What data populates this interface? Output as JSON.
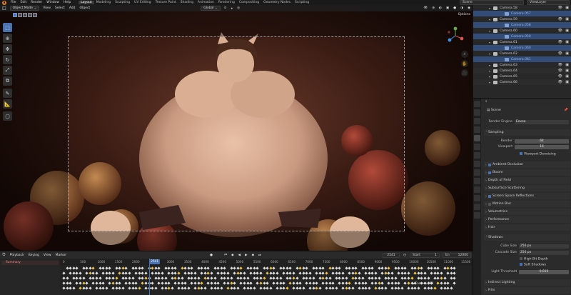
{
  "topbar": {
    "menus": [
      "File",
      "Edit",
      "Render",
      "Window",
      "Help"
    ],
    "workspaces": [
      "Layout",
      "Modeling",
      "Sculpting",
      "UV Editing",
      "Texture Paint",
      "Shading",
      "Animation",
      "Rendering",
      "Compositing",
      "Geometry Nodes",
      "Scripting"
    ],
    "scene_label": "Scene",
    "viewlayer_label": "ViewLayer"
  },
  "viewport": {
    "mode": "Object Mode",
    "menus": [
      "View",
      "Select",
      "Add",
      "Object"
    ],
    "transform_orientation": "Global",
    "options_label": "Options"
  },
  "timeline": {
    "menus": [
      "Playback",
      "Keying",
      "View",
      "Marker"
    ],
    "current_frame": "2541",
    "start_label": "Start",
    "start_value": "1",
    "end_label": "En",
    "end_value": "12000",
    "summary_label": "Summary",
    "ticks": [
      "0",
      "500",
      "1000",
      "1500",
      "2000",
      "2541",
      "3000",
      "3500",
      "4000",
      "4500",
      "5000",
      "5500",
      "6000",
      "6500",
      "7000",
      "7500",
      "8000",
      "8500",
      "9000",
      "9500",
      "10000",
      "10500",
      "11000",
      "11500"
    ],
    "marker_label": "Camera.063"
  },
  "outliner": {
    "rows": [
      {
        "name": "Camera.58",
        "kind": "object",
        "selected": false
      },
      {
        "name": "Camera.057",
        "kind": "camera",
        "selected": true
      },
      {
        "name": "Camera.59",
        "kind": "object",
        "selected": false
      },
      {
        "name": "Camera.058",
        "kind": "camera",
        "selected": true
      },
      {
        "name": "Camera.60",
        "kind": "object",
        "selected": false
      },
      {
        "name": "Camera.059",
        "kind": "camera",
        "selected": true
      },
      {
        "name": "Camera.61",
        "kind": "object",
        "selected": false
      },
      {
        "name": "Camera.060",
        "kind": "camera",
        "selected": true
      },
      {
        "name": "Camera.62",
        "kind": "object",
        "selected": false
      },
      {
        "name": "Camera.061",
        "kind": "camera",
        "selected": true
      },
      {
        "name": "Camera.63",
        "kind": "object",
        "selected": false
      },
      {
        "name": "Camera.64",
        "kind": "object",
        "selected": false
      },
      {
        "name": "Camera.65",
        "kind": "object",
        "selected": false
      },
      {
        "name": "Camera.66",
        "kind": "object",
        "selected": false
      }
    ]
  },
  "properties": {
    "context": "Scene",
    "render_engine_label": "Render Engine",
    "render_engine_value": "Eevee",
    "sampling": {
      "title": "Sampling",
      "render_label": "Render",
      "render_value": "64",
      "viewport_label": "Viewport",
      "viewport_value": "16",
      "denoise_label": "Viewport Denoising"
    },
    "panels": [
      "Ambient Occlusion",
      "Bloom",
      "Depth of Field",
      "Subsurface Scattering",
      "Screen Space Reflections",
      "Motion Blur",
      "Volumetrics",
      "Performance",
      "Hair"
    ],
    "panel_checked": [
      true,
      true,
      false,
      false,
      true,
      false,
      false,
      false,
      false
    ],
    "panel_has_checkbox": [
      true,
      true,
      false,
      false,
      true,
      true,
      false,
      false,
      false
    ],
    "shadows": {
      "title": "Shadows",
      "cube_label": "Cube Size",
      "cube_value": "256 px",
      "cascade_label": "Cascade Size",
      "cascade_value": "256 px",
      "high_bit_label": "High Bit Depth",
      "soft_label": "Soft Shadows",
      "light_threshold_label": "Light Threshold",
      "light_threshold_value": "0.010"
    },
    "more_panels": [
      "Indirect Lighting",
      "Film"
    ]
  }
}
